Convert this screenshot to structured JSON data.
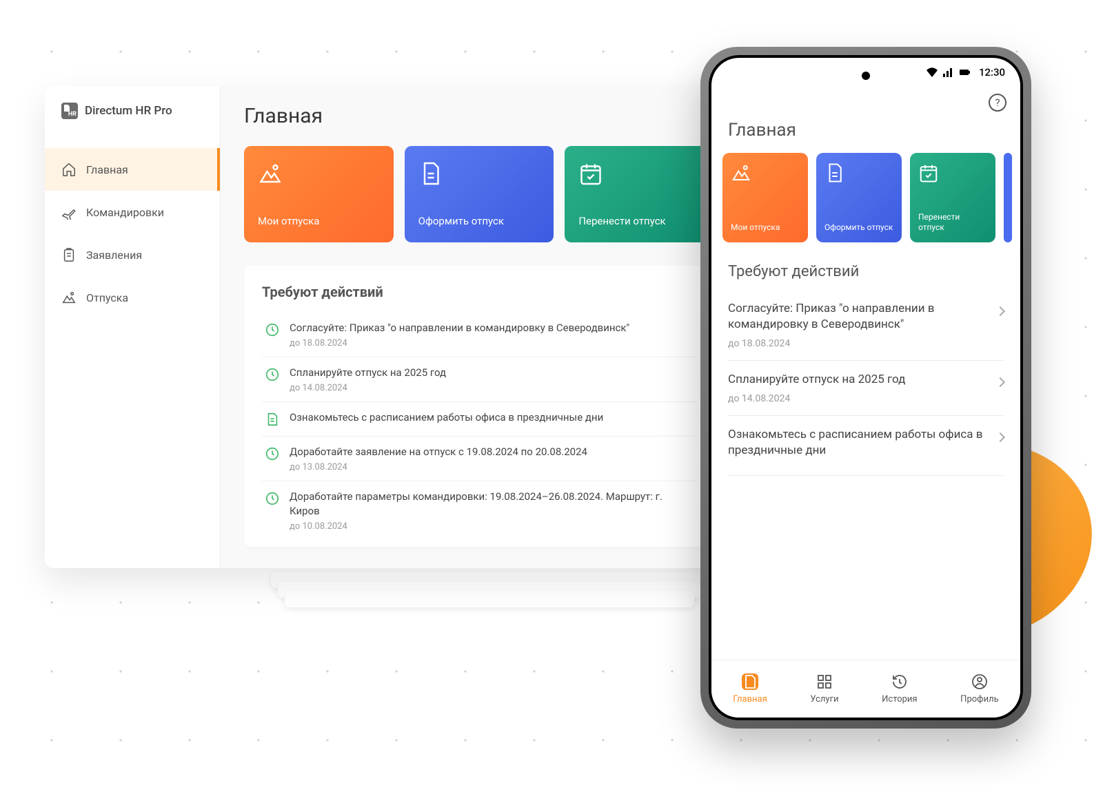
{
  "app": {
    "name": "Directum HR Pro"
  },
  "sidebar": {
    "items": [
      {
        "label": "Главная",
        "icon": "home",
        "active": true
      },
      {
        "label": "Командировки",
        "icon": "plane",
        "active": false
      },
      {
        "label": "Заявления",
        "icon": "clipboard",
        "active": false
      },
      {
        "label": "Отпуска",
        "icon": "mountain",
        "active": false
      }
    ]
  },
  "page": {
    "title": "Главная"
  },
  "tiles": [
    {
      "label": "Мои отпуска",
      "color": "orange",
      "icon": "mountain"
    },
    {
      "label": "Оформить отпуск",
      "color": "blue",
      "icon": "document"
    },
    {
      "label": "Перенести отпуск",
      "color": "green",
      "icon": "calendar-check"
    }
  ],
  "actions": {
    "title": "Требуют действий",
    "items": [
      {
        "icon": "clock",
        "title": "Согласуйте: Приказ \"о направлении в командировку в Северодвинск\"",
        "due": "до 18.08.2024"
      },
      {
        "icon": "clock",
        "title": "Спланируйте отпуск на 2025 год",
        "due": "до 14.08.2024"
      },
      {
        "icon": "doc",
        "title": "Ознакомьтесь с расписанием работы офиса в прездничные дни",
        "due": ""
      },
      {
        "icon": "clock",
        "title": "Доработайте заявление на отпуск с 19.08.2024 по 20.08.2024",
        "due": "до 13.08.2024"
      },
      {
        "icon": "clock",
        "title": "Доработайте параметры командировки: 19.08.2024–26.08.2024. Маршрут: г. Киров",
        "due": "до 10.08.2024"
      }
    ]
  },
  "mobile": {
    "status": {
      "time": "12:30"
    },
    "title": "Главная",
    "tiles": [
      {
        "label": "Мои отпуска",
        "color": "orange",
        "icon": "mountain"
      },
      {
        "label": "Оформить отпуск",
        "color": "blue",
        "icon": "document"
      },
      {
        "label": "Перенести отпуск",
        "color": "green",
        "icon": "calendar-check"
      }
    ],
    "actions": {
      "title": "Требуют действий",
      "items": [
        {
          "title": "Согласуйте: Приказ \"о направлении в командировку в Северодвинск\"",
          "due": "до 18.08.2024"
        },
        {
          "title": "Спланируйте отпуск на 2025 год",
          "due": "до 14.08.2024"
        },
        {
          "title": "Ознакомьтесь с расписанием работы офиса в прездничные дни",
          "due": ""
        }
      ]
    },
    "bottom_nav": [
      {
        "label": "Главная",
        "icon": "logo",
        "active": true
      },
      {
        "label": "Услуги",
        "icon": "grid",
        "active": false
      },
      {
        "label": "История",
        "icon": "history",
        "active": false
      },
      {
        "label": "Профиль",
        "icon": "profile",
        "active": false
      }
    ]
  }
}
